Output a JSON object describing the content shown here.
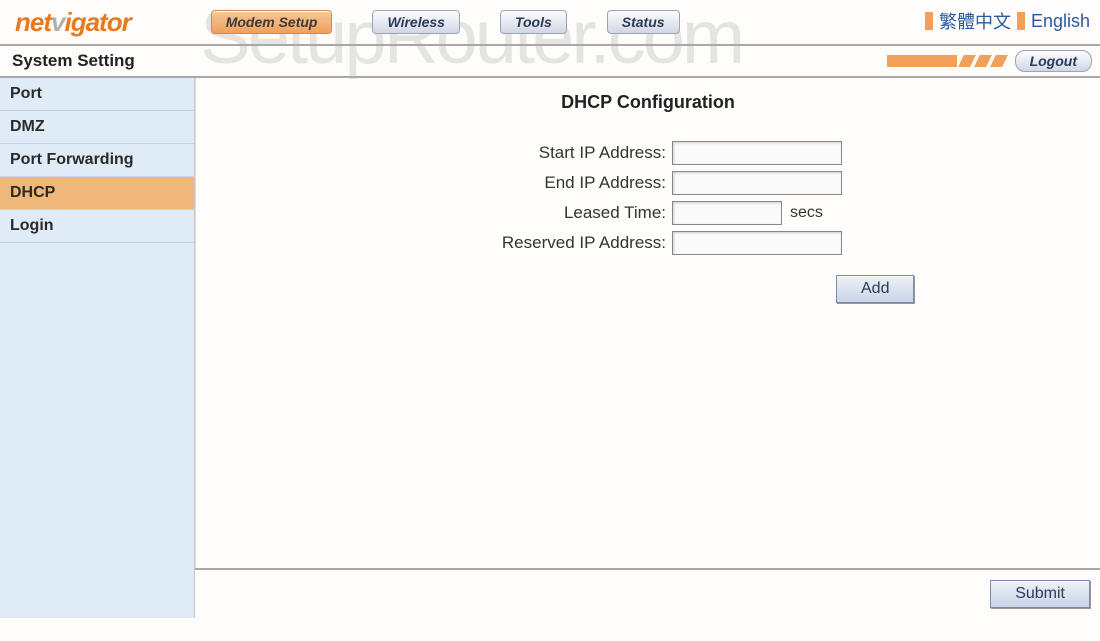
{
  "logo": {
    "part1": "net",
    "part2": "v",
    "part3": "igator"
  },
  "tabs": [
    {
      "label": "Modem Setup",
      "active": true
    },
    {
      "label": "Wireless",
      "active": false
    },
    {
      "label": "Tools",
      "active": false
    },
    {
      "label": "Status",
      "active": false
    }
  ],
  "lang": {
    "chinese": "繁體中文",
    "english": "English"
  },
  "subheader": {
    "title": "System Setting",
    "logout": "Logout"
  },
  "sidebar": {
    "items": [
      {
        "label": "Port",
        "active": false
      },
      {
        "label": "DMZ",
        "active": false
      },
      {
        "label": "Port Forwarding",
        "active": false
      },
      {
        "label": "DHCP",
        "active": true
      },
      {
        "label": "Login",
        "active": false
      }
    ]
  },
  "main": {
    "title": "DHCP Configuration",
    "fields": {
      "start_ip": {
        "label": "Start IP Address:",
        "value": ""
      },
      "end_ip": {
        "label": "End IP Address:",
        "value": ""
      },
      "leased_time": {
        "label": "Leased Time:",
        "value": "",
        "unit": "secs"
      },
      "reserved_ip": {
        "label": "Reserved IP Address:",
        "value": ""
      }
    },
    "add_button": "Add",
    "submit_button": "Submit"
  },
  "watermark": "SetupRouter.com"
}
